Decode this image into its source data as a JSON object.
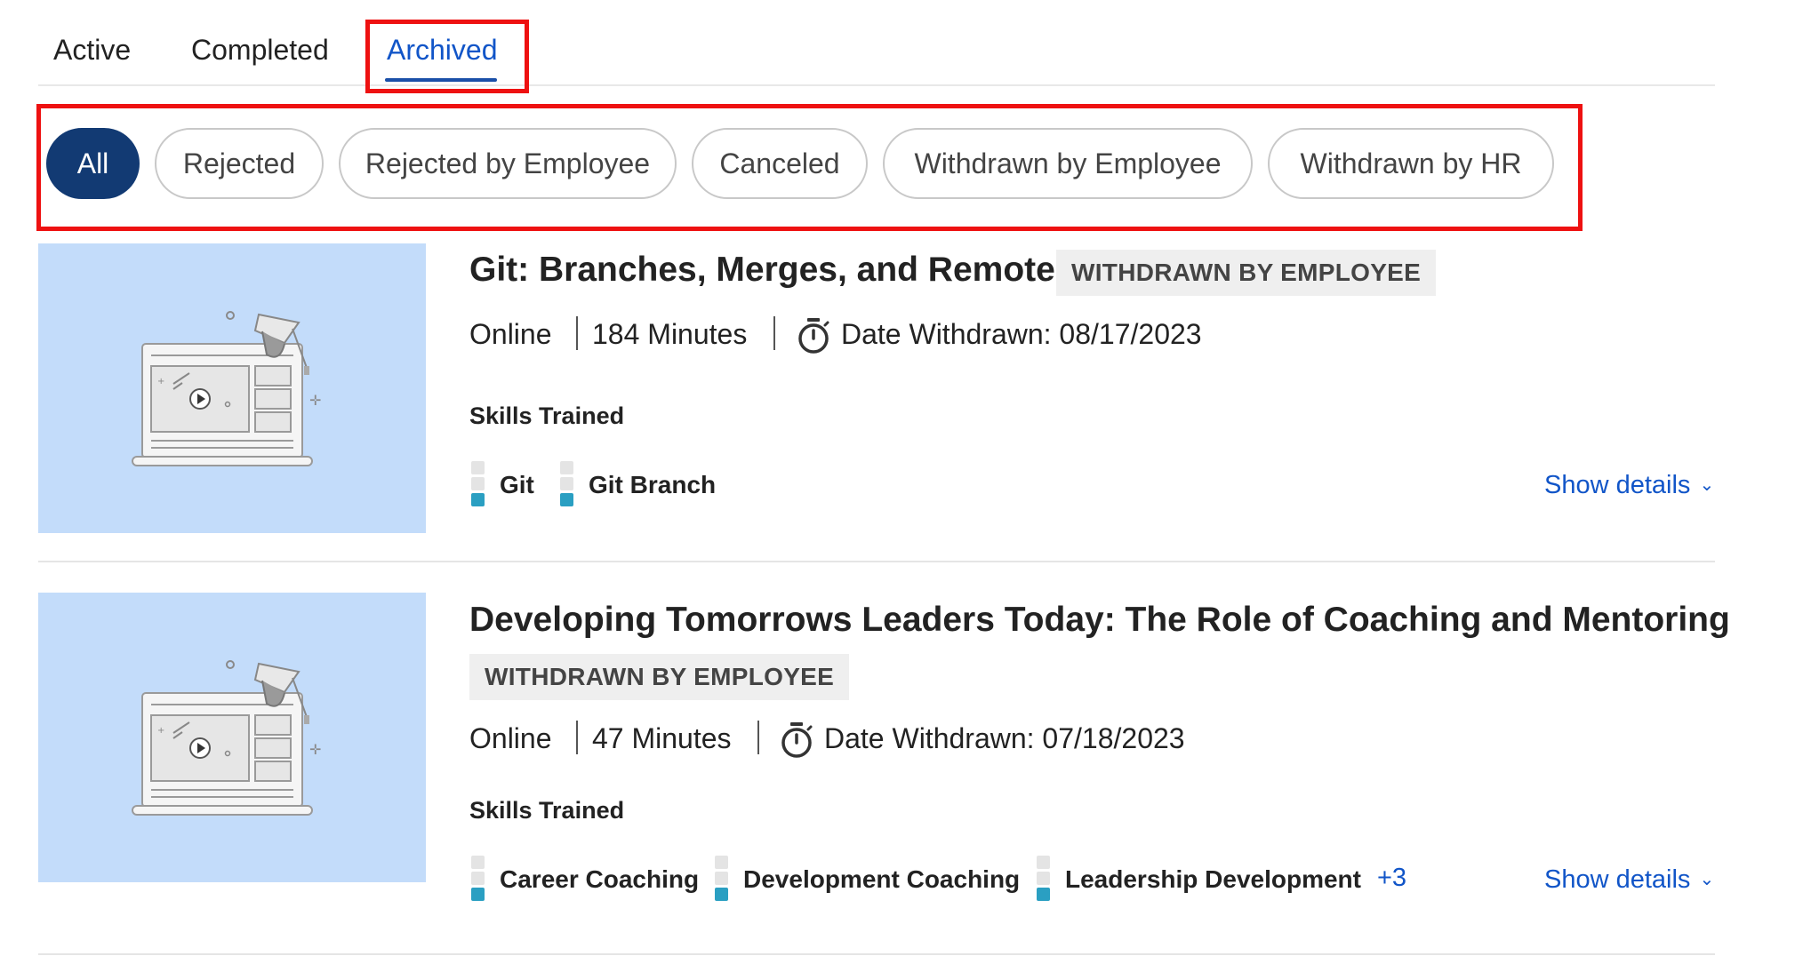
{
  "tabs": [
    {
      "label": "Active"
    },
    {
      "label": "Completed"
    },
    {
      "label": "Archived",
      "active": true
    }
  ],
  "filters": [
    {
      "label": "All",
      "selected": true
    },
    {
      "label": "Rejected"
    },
    {
      "label": "Rejected by Employee"
    },
    {
      "label": "Canceled"
    },
    {
      "label": "Withdrawn by Employee"
    },
    {
      "label": "Withdrawn by HR"
    }
  ],
  "courses": [
    {
      "title": "Git: Branches, Merges, and Remotes",
      "status": "WITHDRAWN BY EMPLOYEE",
      "format": "Online",
      "duration": "184 Minutes",
      "date_label": "Date Withdrawn: 08/17/2023",
      "skills_label": "Skills Trained",
      "skills": [
        {
          "name": "Git",
          "level": 1
        },
        {
          "name": "Git Branch",
          "level": 1
        }
      ],
      "show_details": "Show details"
    },
    {
      "title": "Developing Tomorrows Leaders Today: The Role of Coaching and Mentoring",
      "status": "WITHDRAWN BY EMPLOYEE",
      "format": "Online",
      "duration": "47 Minutes",
      "date_label": "Date Withdrawn: 07/18/2023",
      "skills_label": "Skills Trained",
      "skills": [
        {
          "name": "Career Coaching",
          "level": 1
        },
        {
          "name": "Development Coaching",
          "level": 1
        },
        {
          "name": "Leadership Development",
          "level": 1
        }
      ],
      "more_skills": "+3",
      "show_details": "Show details"
    }
  ],
  "colors": {
    "accent": "#1155c8",
    "selected_chip": "#123a73",
    "highlight": "#ee1111",
    "thumbnail_bg": "#c3dcfa",
    "skill_level": "#2a9fc2"
  },
  "icons": [
    "timer-icon",
    "chevron-down-icon",
    "course-illustration"
  ]
}
